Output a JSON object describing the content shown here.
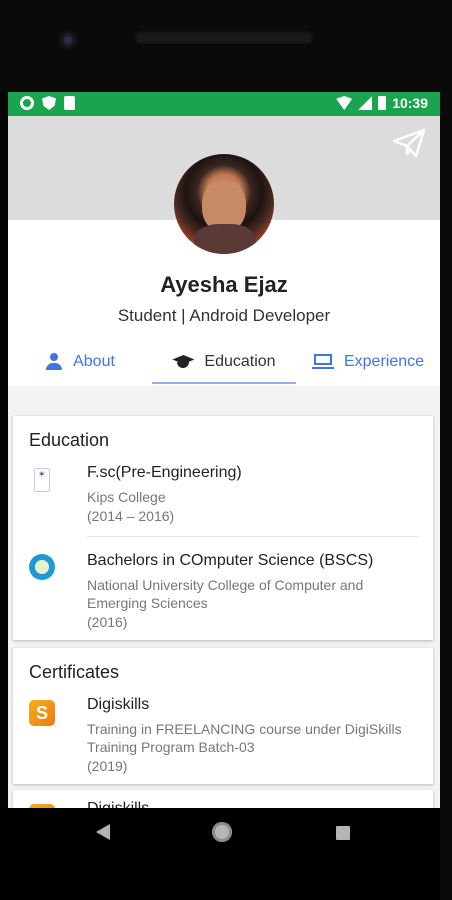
{
  "statusbar": {
    "time": "10:39"
  },
  "profile": {
    "name": "Ayesha Ejaz",
    "role": "Student | Android Developer"
  },
  "tabs": [
    {
      "label": "About",
      "icon": "person-icon"
    },
    {
      "label": "Education",
      "icon": "graduation-cap-icon",
      "active": true
    },
    {
      "label": "Experience",
      "icon": "laptop-icon"
    }
  ],
  "education": {
    "title": "Education",
    "items": [
      {
        "title": "F.sc(Pre-Engineering)",
        "institution": "Kips College",
        "date": "(2014 – 2016)",
        "icon": "kips-logo-icon"
      },
      {
        "title": "Bachelors in COmputer Science (BSCS)",
        "institution": "National University College of Computer and Emerging Sciences",
        "date": "(2016)",
        "icon": "nu-logo-icon"
      }
    ]
  },
  "certificates": {
    "title": "Certificates",
    "items": [
      {
        "title": "Digiskills",
        "description": "Training in FREELANCING course under DigiSkills Training Program Batch-03",
        "date": "(2019)",
        "icon": "digiskills-logo-icon"
      },
      {
        "title": "Digiskills"
      }
    ]
  },
  "colors": {
    "statusbar": "#1aa44f",
    "accent": "#3f74e6"
  }
}
